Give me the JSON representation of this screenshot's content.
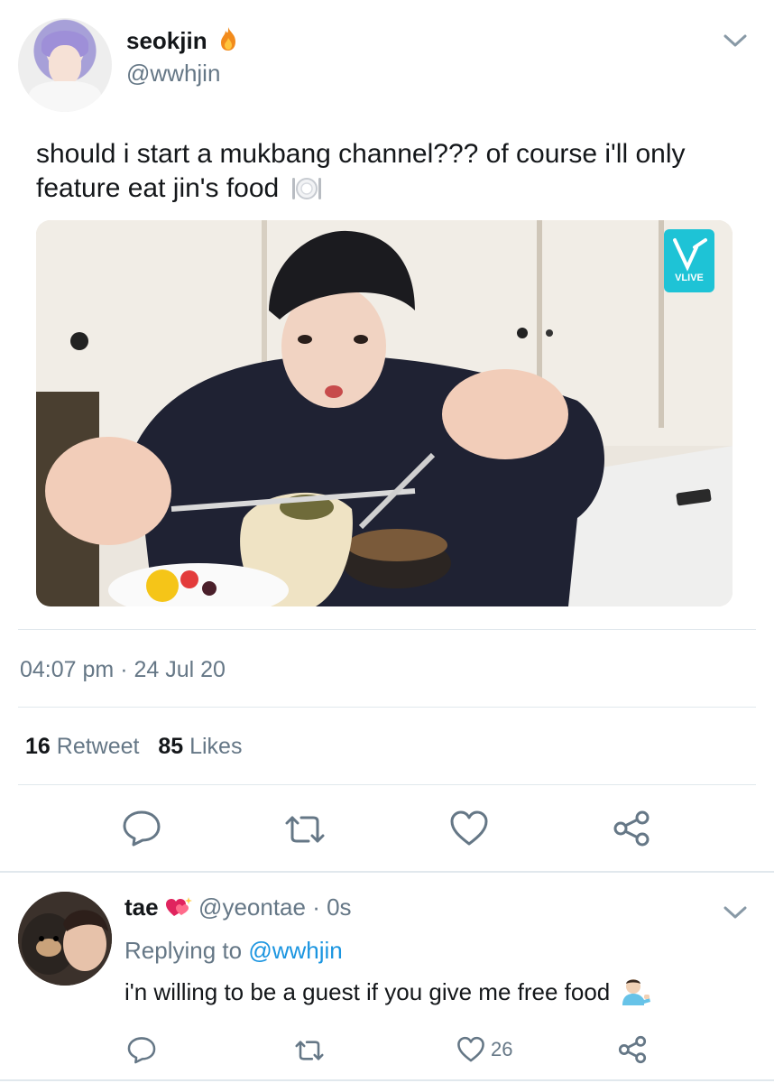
{
  "tweet": {
    "name": "seokjin",
    "name_emoji": "fire",
    "handle": "@wwhjin",
    "text": "should i start a mukbang channel??? of course i'll only feature eat jin's food",
    "media_badge": "VLIVE",
    "time": "04:07 pm",
    "separator": "·",
    "date": "24 Jul 20",
    "retweet_count": "16",
    "retweet_label": "Retweet",
    "like_count": "85",
    "like_label": "Likes"
  },
  "reply": {
    "name": "tae",
    "handle": "@yeontae",
    "time": "· 0s",
    "replying_prefix": "Replying to",
    "replying_to": "@wwhjin",
    "text": "i'n willing to be a guest if you give me free food",
    "like_count": "26"
  },
  "colors": {
    "muted": "#657786",
    "link": "#1b95e0",
    "divider": "#e1e8ed"
  }
}
